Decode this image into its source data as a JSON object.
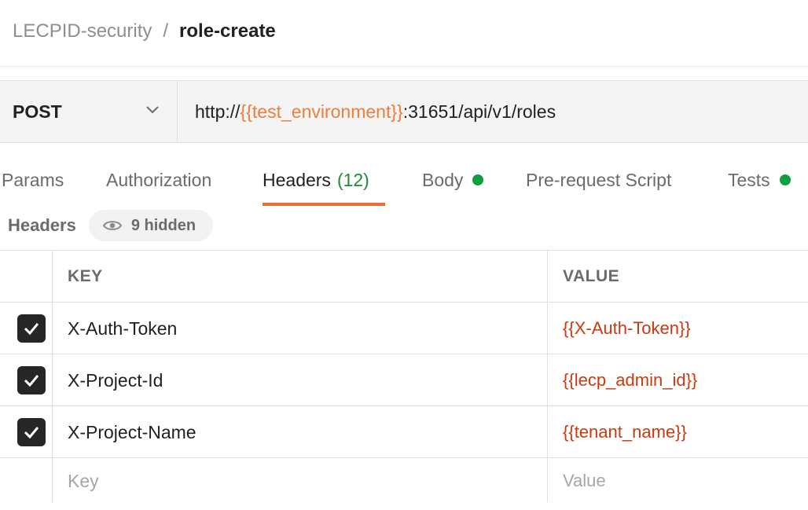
{
  "breadcrumb": {
    "parent": "LECPID-security",
    "separator": "/",
    "current": "role-create"
  },
  "request": {
    "method": "POST",
    "url_prefix": "http://",
    "url_variable": "{{test_environment}}",
    "url_suffix": ":31651/api/v1/roles"
  },
  "tabs": [
    {
      "label": "Params"
    },
    {
      "label": "Authorization"
    },
    {
      "label": "Headers",
      "count": "(12)",
      "active": true
    },
    {
      "label": "Body",
      "dot": true
    },
    {
      "label": "Pre-request Script"
    },
    {
      "label": "Tests",
      "dot": true
    }
  ],
  "headers_section": {
    "title": "Headers",
    "hidden_label": "9 hidden"
  },
  "table": {
    "columns": {
      "key": "KEY",
      "value": "VALUE"
    },
    "rows": [
      {
        "key": "X-Auth-Token",
        "value": "{{X-Auth-Token}}",
        "checked": true
      },
      {
        "key": "X-Project-Id",
        "value": "{{lecp_admin_id}}",
        "checked": true
      },
      {
        "key": "X-Project-Name",
        "value": "{{tenant_name}}",
        "checked": true
      }
    ],
    "new_row": {
      "key_placeholder": "Key",
      "value_placeholder": "Value"
    }
  },
  "colors": {
    "accent": "#ef6a36",
    "variable": "#ef7d3a",
    "value_text": "#c93a10",
    "status_dot": "#0d9e3f",
    "count": "#1f8a3e"
  },
  "icons": {
    "method_dropdown": "chevron-down-icon",
    "hidden": "eye-icon",
    "checkbox": "check-icon"
  }
}
